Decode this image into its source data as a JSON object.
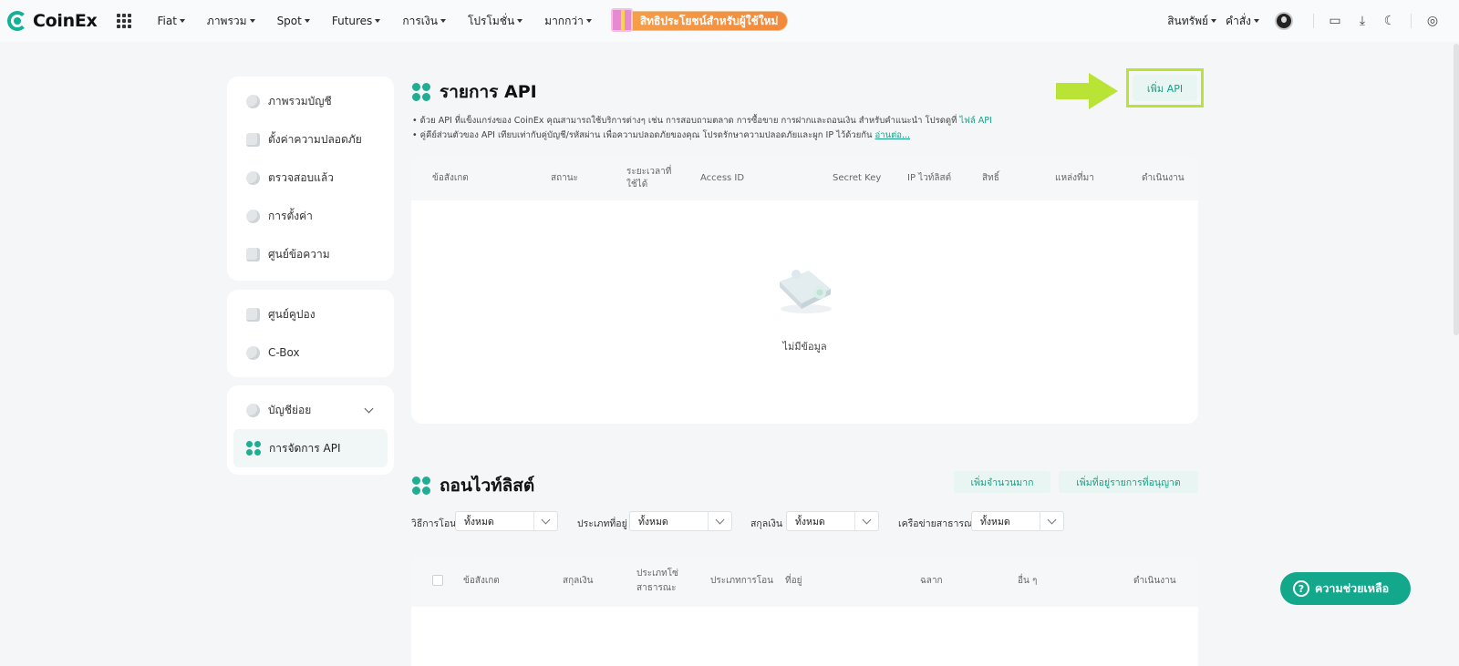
{
  "brand": {
    "name": "CoinEx",
    "accent": "#13b195"
  },
  "nav": {
    "items": [
      "Fiat",
      "ภาพรวม",
      "Spot",
      "Futures",
      "การเงิน",
      "โปรโมชั่น",
      "มากกว่า"
    ],
    "promo": "สิทธิประโยชน์สำหรับผู้ใช้ใหม่",
    "right": [
      "สินทรัพย์",
      "คำสั่ง"
    ]
  },
  "sidebar": {
    "group1": [
      "ภาพรวมบัญชี",
      "ตั้งค่าความปลอดภัย",
      "ตรวจสอบแล้ว",
      "การตั้งค่า",
      "ศูนย์ข้อความ"
    ],
    "group2": [
      "ศูนย์คูปอง",
      "C-Box"
    ],
    "group3_header": "บัญชีย่อย",
    "active": "การจัดการ API"
  },
  "api": {
    "title": "รายการ API",
    "add_button": "เพิ่ม API",
    "note1": "• ด้วย API ที่แข็งแกร่งของ CoinEx คุณสามารถใช้บริการต่างๆ เช่น การสอบถามตลาด การซื้อขาย การฝากและถอนเงิน สำหรับคำแนะนำ โปรดดูที่ ",
    "note1_link": "ไฟล์ API",
    "note2": "• คู่คีย์ส่วนตัวของ API เทียบเท่ากับคู่บัญชี/รหัสผ่าน เพื่อความปลอดภัยของคุณ โปรดรักษาความปลอดภัยและผูก IP ไว้ด้วยกัน ",
    "note2_link": "อ่านต่อ...",
    "columns": [
      "ข้อสังเกต",
      "สถานะ",
      "ระยะเวลาที่ ใช้ได้",
      "Access ID",
      "Secret Key",
      "IP ไวท์ลิสต์",
      "สิทธิ์",
      "แหล่งที่มา",
      "ดำเนินงาน"
    ],
    "empty": "ไม่มีข้อมูล"
  },
  "whitelist": {
    "title": "ถอนไวท์ลิสต์",
    "bulk_add": "เพิ่มจำนวนมาก",
    "add_address": "เพิ่มที่อยู่รายการที่อนุญาต",
    "filters": [
      {
        "label": "วิธีการโอน",
        "value": "ทั้งหมด"
      },
      {
        "label": "ประเภทที่อยู่",
        "value": "ทั้งหมด"
      },
      {
        "label": "สกุลเงิน",
        "value": "ทั้งหมด"
      },
      {
        "label": "เครือข่ายสาธารณะ",
        "value": "ทั้งหมด"
      }
    ],
    "columns": [
      "ข้อสังเกต",
      "สกุลเงิน",
      "ประเภทโซ่ สาธารณะ",
      "ประเภทการโอน",
      "ที่อยู่",
      "ฉลาก",
      "อื่น ๆ",
      "ดำเนินงาน"
    ]
  },
  "help": "ความช่วยเหลือ"
}
